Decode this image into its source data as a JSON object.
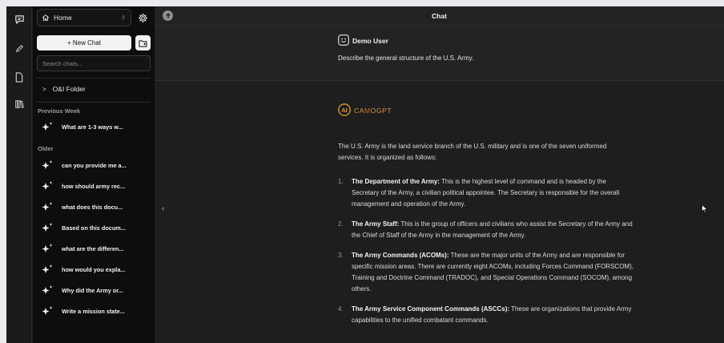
{
  "sidebar": {
    "workspace": "Home",
    "new_chat_label": "+ New Chat",
    "search_placeholder": "Search chats...",
    "folder": "O&I Folder",
    "sections": [
      {
        "title": "Previous Week",
        "items": [
          "What are 1-3 ways w..."
        ]
      },
      {
        "title": "Older",
        "items": [
          "can you provide me a...",
          "how should army rec...",
          "what does this docu...",
          "Based on this docum...",
          "what are the differen...",
          "how would you expla...",
          "Why did the Army or...",
          "Write a mission state..."
        ]
      }
    ]
  },
  "header": {
    "title": "Chat"
  },
  "user_message": {
    "author": "Demo User",
    "text": "Describe the general structure of the U.S. Army."
  },
  "assistant": {
    "name_prefix": "CA",
    "name_highlight": "M",
    "name_suffix": "OGPT",
    "intro": "The U.S. Army is the land service branch of the U.S. military and is one of the seven uniformed services. It is organized as follows:",
    "items": [
      {
        "num": "1.",
        "term": "The Department of the Army:",
        "text": " This is the highest level of command and is headed by the Secretary of the Army, a civilian political appointee. The Secretary is responsible for the overall management and operation of the Army."
      },
      {
        "num": "2.",
        "term": "The Army Staff:",
        "text": " This is the group of officers and civilians who assist the Secretary of the Army and the Chief of Staff of the Army in the management of the Army."
      },
      {
        "num": "3.",
        "term": "The Army Commands (ACOMs):",
        "text": " These are the major units of the Army and are responsible for specific mission areas. There are currently eight ACOMs, including Forces Command (FORSCOM), Training and Doctrine Command (TRADOC), and Special Operations Command (SOCOM), among others."
      },
      {
        "num": "4.",
        "term": "The Army Service Component Commands (ASCCs):",
        "text": " These are organizations that provide Army capabilities to the unified combatant commands."
      }
    ]
  },
  "collapse_glyph": "‹",
  "colors": {
    "brand": "#d89a3c",
    "background": "#1e1e1e",
    "sidebar": "#0d0d0d"
  }
}
